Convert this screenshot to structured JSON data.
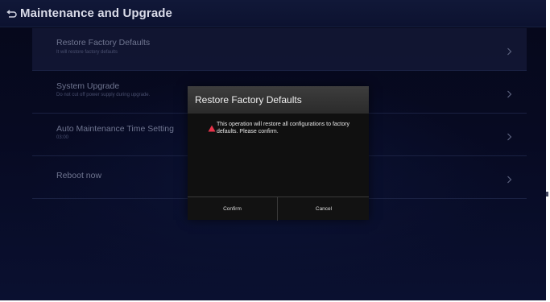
{
  "header": {
    "title": "Maintenance and Upgrade",
    "back_icon": "back-return-icon"
  },
  "list": {
    "items": [
      {
        "title": "Restore Factory Defaults",
        "subtitle": "It will restore factory defaults"
      },
      {
        "title": "System Upgrade",
        "subtitle": "Do not cut off power supply during upgrade."
      },
      {
        "title": "Auto Maintenance Time Setting",
        "subtitle": "03:00"
      },
      {
        "title": "Reboot now",
        "subtitle": ""
      }
    ],
    "chevron_icon": "chevron-right-icon"
  },
  "dialog": {
    "title": "Restore Factory Defaults",
    "message": "This operation will restore all configurations to factory defaults. Please confirm.",
    "warning_icon": "warning-triangle-icon",
    "warning_color": "#e8334a",
    "confirm_label": "Confirm",
    "cancel_label": "Cancel"
  },
  "colors": {
    "background": "#070a22",
    "header": "#0f1634",
    "dialog_header": "#333333",
    "dialog_body": "#101010"
  }
}
